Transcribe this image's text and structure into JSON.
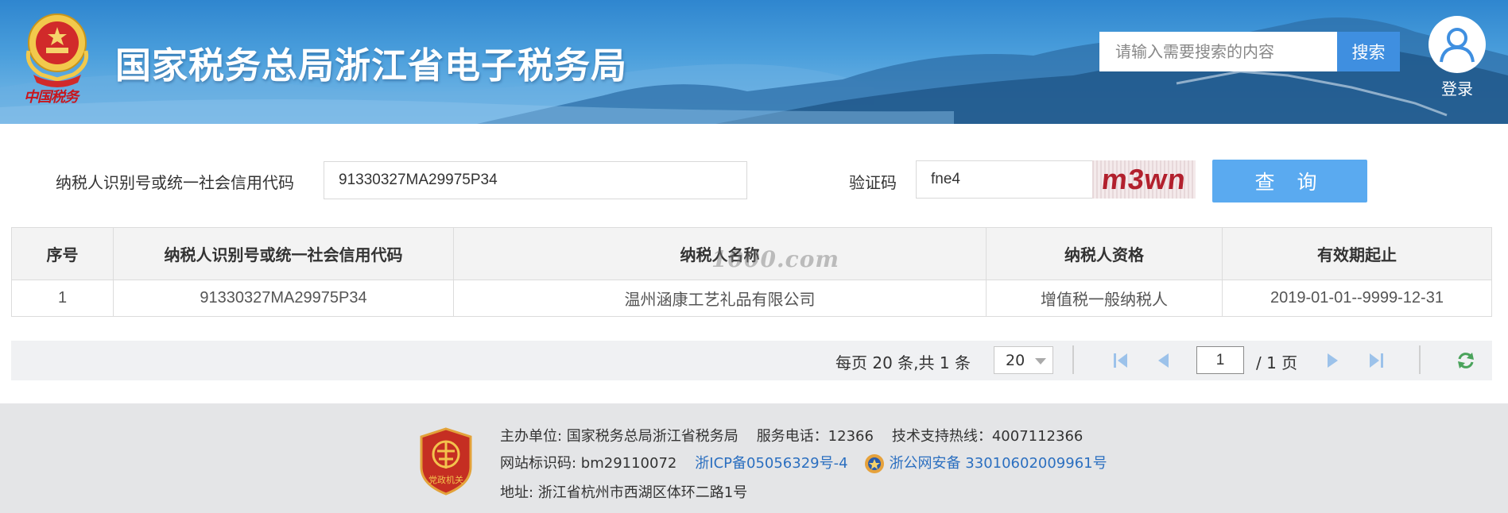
{
  "header": {
    "title": "国家税务总局浙江省电子税务局",
    "emblem_caption": "中国税务",
    "search_placeholder": "请输入需要搜索的内容",
    "search_button": "搜索",
    "login_label": "登录"
  },
  "query_form": {
    "taxpayer_id_label": "纳税人识别号或统一社会信用代码",
    "taxpayer_id_value": "91330327MA29975P34",
    "captcha_label": "验证码",
    "captcha_input_value": "fne4",
    "captcha_image_text": "m3wn",
    "query_button": "查 询"
  },
  "results_table": {
    "columns": [
      "序号",
      "纳税人识别号或统一社会信用代码",
      "纳税人名称",
      "纳税人资格",
      "有效期起止"
    ],
    "rows": [
      [
        "1",
        "91330327MA29975P34",
        "温州涵康工艺礼品有限公司",
        "增值税一般纳税人",
        "2019-01-01--9999-12-31"
      ]
    ],
    "watermark": "1000.com"
  },
  "pager": {
    "summary": "每页 20 条,共 1 条",
    "page_size": "20",
    "current_page": "1",
    "total_pages": "/ 1 页"
  },
  "footer": {
    "badge_text": "党政机关",
    "sponsor": "主办单位:  国家税务总局浙江省税务局",
    "service_phone": "服务电话：12366",
    "support_hotline": "技术支持热线：4007112366",
    "site_id": "网站标识码:   bm29110072",
    "icp": "浙ICP备05056329号-4",
    "police_record": "浙公网安备 33010602009961号",
    "address": "地址:   浙江省杭州市西湖区体环二路1号"
  },
  "colors": {
    "banner": "#3f8fd6",
    "query_button": "#5aaaf0",
    "search_button": "#3f8fe0",
    "link": "#2b6fc0",
    "footer_bg": "#e4e5e7"
  }
}
